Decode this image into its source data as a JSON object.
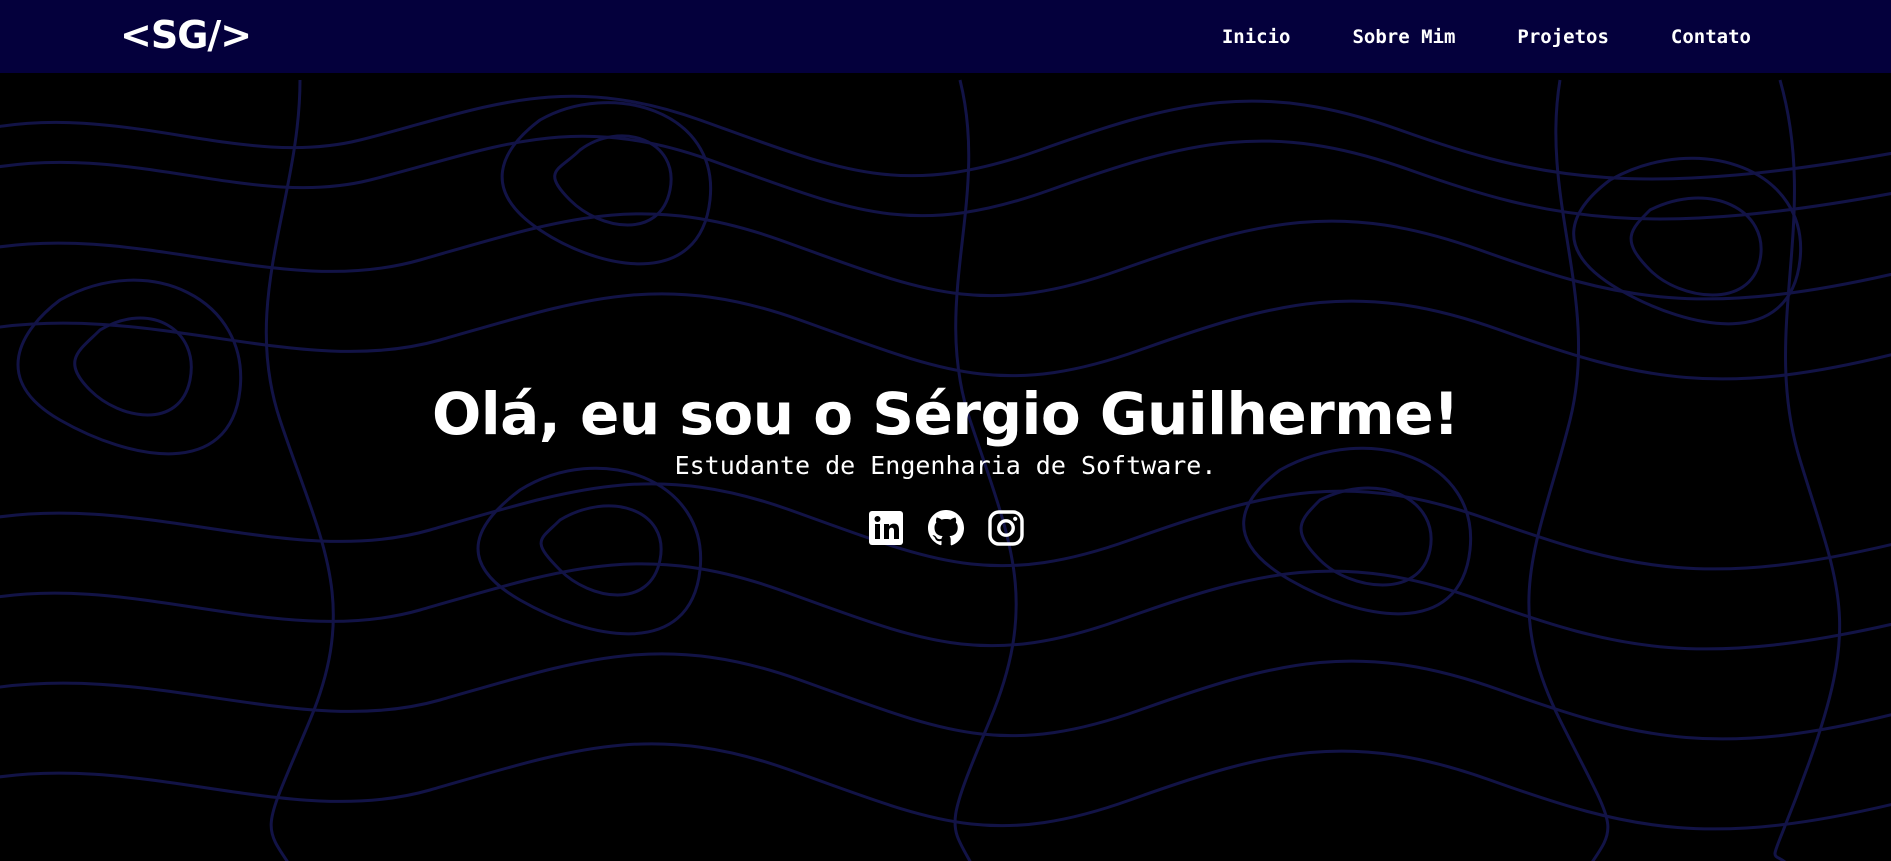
{
  "header": {
    "logo": "<SG/>",
    "nav": [
      "Inicio",
      "Sobre Mim",
      "Projetos",
      "Contato"
    ]
  },
  "hero": {
    "title": "Olá, eu sou o Sérgio Guilherme!",
    "subtitle": "Estudante de Engenharia de Software."
  },
  "socials": [
    "linkedin-icon",
    "github-icon",
    "instagram-icon"
  ],
  "colors": {
    "header_bg": "#04003c",
    "page_bg": "#000000",
    "contour_lines": "#121346",
    "text": "#ffffff"
  }
}
